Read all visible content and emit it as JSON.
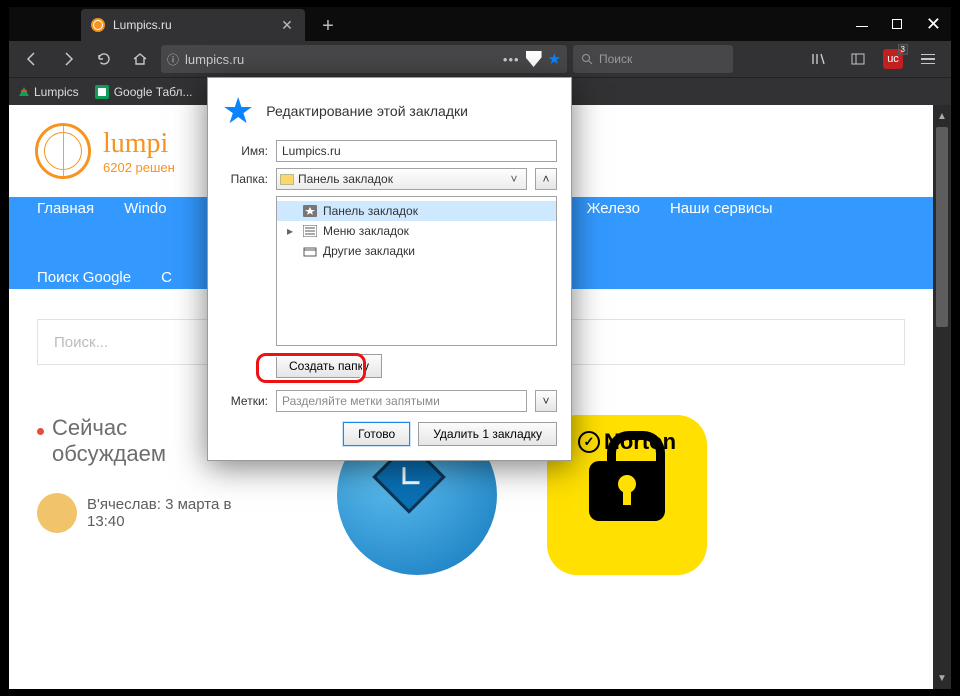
{
  "window": {
    "minimize": "—",
    "maximize": "□",
    "close": "✕"
  },
  "tab": {
    "title": "Lumpics.ru",
    "close": "✕",
    "newtab": "+"
  },
  "toolbar": {
    "url": "lumpics.ru",
    "ellipsis": "•••",
    "search_placeholder": "Поиск",
    "badge": "uc",
    "badge_count": "3"
  },
  "bookmarksbar": {
    "items": [
      {
        "label": "Lumpics"
      },
      {
        "label": "Google Табл..."
      }
    ]
  },
  "site": {
    "name": "lumpi",
    "tagline": "6202 решен"
  },
  "nav": {
    "items": [
      "Главная",
      "Windo",
      "Железо",
      "Наши сервисы",
      "Поиск Google",
      "С"
    ]
  },
  "search": {
    "placeholder": "Поиск..."
  },
  "discuss": {
    "heading1": "Сейчас",
    "heading2": "обсуждаем",
    "author": "В'ячеслав:",
    "date": "3 марта в",
    "time": "13:40"
  },
  "norton": {
    "brand": "Norton",
    "check": "✓"
  },
  "panel": {
    "title": "Редактирование этой закладки",
    "name_label": "Имя:",
    "name_value": "Lumpics.ru",
    "folder_label": "Папка:",
    "folder_value": "Панель закладок",
    "tree": [
      {
        "label": "Панель закладок",
        "selected": true,
        "icon": "star-box"
      },
      {
        "label": "Меню закладок",
        "selected": false,
        "icon": "list-box",
        "expandable": true
      },
      {
        "label": "Другие закладки",
        "selected": false,
        "icon": "tray"
      }
    ],
    "create_label": "Создать папку",
    "tags_label": "Метки:",
    "tags_placeholder": "Разделяйте метки запятыми",
    "done": "Готово",
    "delete": "Удалить 1 закладку",
    "chevron_up": "˄",
    "chevron_down": "˅"
  }
}
